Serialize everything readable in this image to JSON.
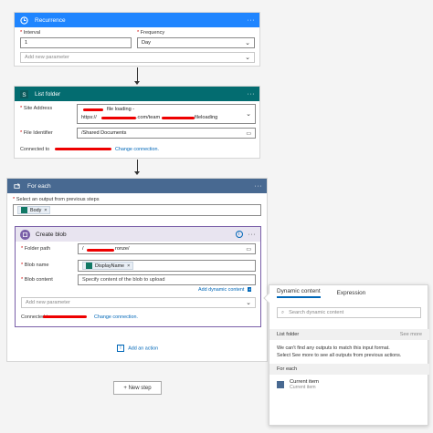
{
  "recurrence": {
    "title": "Recurrence",
    "menu": "···",
    "interval_label": "Interval",
    "interval_value": "1",
    "frequency_label": "Frequency",
    "frequency_value": "Day",
    "add_param": "Add new parameter",
    "color": "#1f85ff"
  },
  "list_folder": {
    "title": "List folder",
    "menu": "···",
    "site_label": "Site Address",
    "site_line1": "file loading -",
    "site_line2_a": "https://",
    "site_line2_b": ".com/team",
    "site_line2_c": "fileloading",
    "file_label": "File Identifier",
    "file_value": "/Shared Documents",
    "connected": "Connected to",
    "change_conn": "Change connection.",
    "color": "#036c70"
  },
  "for_each": {
    "title": "For each",
    "menu": "···",
    "select_label": "Select an output from previous steps",
    "token": "Body",
    "token_close": "×",
    "color": "#486991",
    "add_action": "Add an action"
  },
  "create_blob": {
    "title": "Create blob",
    "menu": "···",
    "folder_label": "Folder path",
    "folder_value_a": "/",
    "folder_value_b": "ronze/",
    "blob_name_label": "Blob name",
    "blob_name_token": "DisplayName",
    "blob_content_label": "Blob content",
    "blob_content_placeholder": "Specify content of the blob to upload",
    "add_dynamic": "Add dynamic content",
    "add_param": "Add new parameter",
    "connected": "Connected to",
    "change_conn": "Change connection.",
    "header_bg": "#e8e4f0",
    "border": "#7a5fa8"
  },
  "new_step": "+ New step",
  "dynamic_panel": {
    "tab_dynamic": "Dynamic content",
    "tab_expression": "Expression",
    "search_placeholder": "Search dynamic content",
    "section_list_folder": "List folder",
    "see_more": "See more",
    "notice_line1": "We can't find any outputs to match this input format.",
    "notice_line2": "Select See more to see all outputs from previous actions.",
    "section_for_each": "For each",
    "item_title": "Current item",
    "item_sub": "Current item"
  }
}
